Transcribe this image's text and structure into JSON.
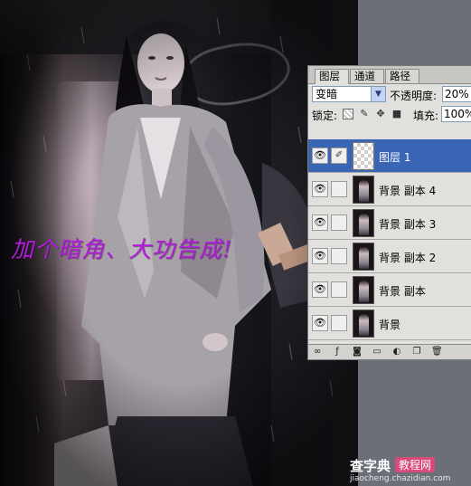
{
  "caption": "加个暗角、大功告成!",
  "watermark": {
    "main": "查字典",
    "badge": "教程网",
    "url": "jiaocheng.chazidian.com"
  },
  "layers_panel": {
    "tabs": [
      "图层",
      "通道",
      "路径"
    ],
    "active_tab": 0,
    "blend_mode": "变暗",
    "opacity_label": "不透明度:",
    "opacity_value": "20%",
    "lock_label": "锁定:",
    "fill_label": "填充:",
    "fill_value": "100%",
    "layers": [
      {
        "name": "图层 1",
        "selected": true,
        "thumb": "transparent"
      },
      {
        "name": "背景 副本 4",
        "selected": false,
        "thumb": "photo"
      },
      {
        "name": "背景 副本 3",
        "selected": false,
        "thumb": "photo"
      },
      {
        "name": "背景 副本 2",
        "selected": false,
        "thumb": "photo"
      },
      {
        "name": "背景 副本",
        "selected": false,
        "thumb": "photo"
      },
      {
        "name": "背景",
        "selected": false,
        "thumb": "photo"
      }
    ],
    "icons": {
      "eye": "eye-icon",
      "brush": "brush-icon",
      "lock_transparent": "lock-transparency-icon",
      "lock_paint": "lock-paint-icon",
      "lock_move": "lock-move-icon",
      "lock_all": "lock-all-icon",
      "bottom": [
        "link-layers-icon",
        "layer-style-icon",
        "layer-mask-icon",
        "new-group-icon",
        "adjustment-layer-icon",
        "new-layer-icon",
        "delete-layer-icon"
      ]
    }
  },
  "colors": {
    "selected_layer": "#3a64b4",
    "caption": "#b21cd8",
    "workspace": "#6a6f78"
  }
}
